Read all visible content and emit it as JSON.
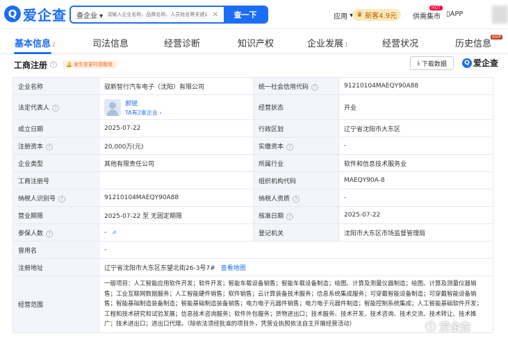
{
  "topbar": {
    "logo_mark": "Q",
    "logo_text": "爱企查",
    "search_scope": "查企业",
    "search_placeholder": "请输入企业名称、品牌名称、人员姓名等关键词",
    "search_button": "查一下",
    "nav_app": "应用",
    "vip_label": "新客4.9元",
    "hot_badge": "HOT",
    "supply_label": "供需集市",
    "download_app": "APP"
  },
  "tabs": [
    {
      "label": "基本信息",
      "count": "2"
    },
    {
      "label": "司法信息"
    },
    {
      "label": "经营诊断"
    },
    {
      "label": "知识产权"
    },
    {
      "label": "企业发展",
      "count": "1"
    },
    {
      "label": "经营状况"
    },
    {
      "label": "历史信息"
    }
  ],
  "svip_badge": "SVIP",
  "section": {
    "title": "工商注册",
    "remind": "发生变更时提醒我",
    "download": "下载数据",
    "brand": "爱企查"
  },
  "table": {
    "company_name_label": "企业名称",
    "company_name": "驭新智行汽车电子（沈阳）有限公司",
    "credit_code_label": "统一社会信用代码",
    "credit_code": "91210104MAEQY90A88",
    "legal_rep_label": "法定代表人",
    "legal_rep_name": "郝锐",
    "legal_rep_sub": "TA有2家企业 ›",
    "status_label": "经营状态",
    "status": "开业",
    "founded_label": "成立日期",
    "founded": "2025-07-22",
    "district_label": "行政区划",
    "district": "辽宁省沈阳市大东区",
    "capital_label": "注册资本",
    "capital": "20,000万(元)",
    "paid_capital_label": "实缴资本",
    "paid_capital": "-",
    "type_label": "企业类型",
    "type": "其他有限责任公司",
    "industry_label": "所属行业",
    "industry": "软件和信息技术服务业",
    "reg_no_label": "工商注册号",
    "reg_no": "",
    "org_code_label": "组织机构代码",
    "org_code": "MAEQY90A-8",
    "tax_id_label": "纳税人识别号",
    "tax_id": "91210104MAEQY90A88",
    "taxpayer_label": "纳税人资质",
    "taxpayer": "-",
    "term_label": "营业期限",
    "term": "2025-07-22 至 无固定期限",
    "approval_label": "核准日期",
    "approval": "2025-07-22",
    "insured_label": "参保人数",
    "insured": "-",
    "authority_label": "登记机关",
    "authority": "沈阳市大东区市场监督管理局",
    "former_name_label": "曾用名",
    "former_name": "-",
    "address_label": "注册地址",
    "address": "辽宁省沈阳市大东区东望北街26-3号7#",
    "map_link": "查看地图",
    "scope_label": "经营范围",
    "scope": "一般项目：人工智能应用软件开发；软件开发；智能车载设备销售；智能车载设备制造；绘图、计算及测量仪器制造；绘图、计算及测量仪器销售；工业互联网数据服务；人工智能硬件销售；软件销售；云计算装备技术服务；信息系统集成服务；可穿戴智能设备制造；可穿戴智能设备销售；智能基础制造装备制造；智能基础制造装备销售；电力电子元器件销售；电力电子元器件制造；智能控制系统集成；人工智能基础软件开发；工程和技术研究和试验发展；信息技术咨询服务；软件外包服务；货物进出口；技术服务、技术开发、技术咨询、技术交流、技术转让、技术推广；技术进出口；进出口代理。（除依法须经批准的项目外，凭营业执照依法自主开展经营活动）"
  },
  "watermark": "爱企查"
}
